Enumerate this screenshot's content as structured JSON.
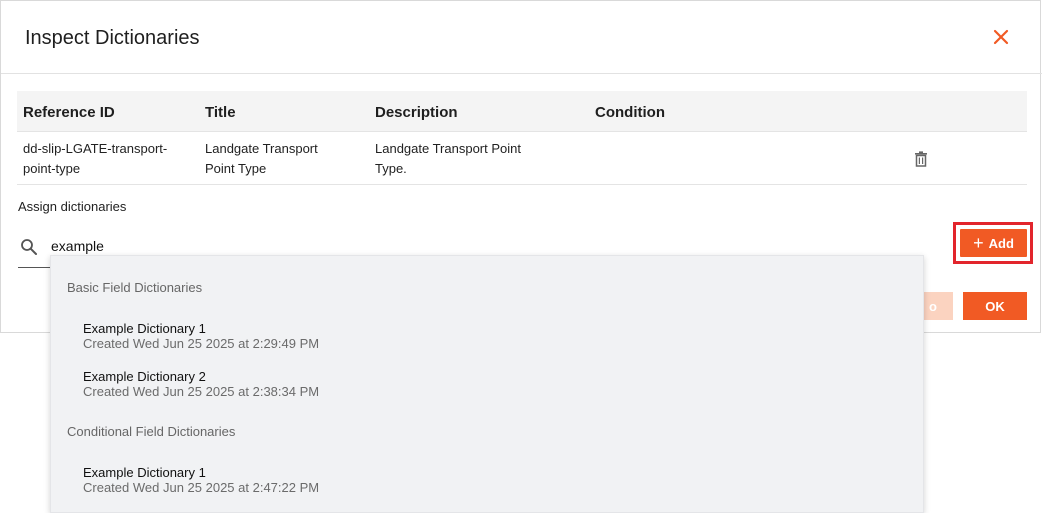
{
  "dialog": {
    "title": "Inspect Dictionaries",
    "close_icon": "close-icon",
    "accent_color": "#f15a24"
  },
  "table": {
    "headers": [
      "Reference ID",
      "Title",
      "Description",
      "Condition"
    ],
    "rows": [
      {
        "reference_id": "dd-slip-LGATE-transport-point-type",
        "title": "Landgate Transport Point Type",
        "description": "Landgate Transport Point Type.",
        "condition": "",
        "action_icon": "trash-icon"
      }
    ]
  },
  "assign": {
    "label": "Assign dictionaries",
    "search_value": "example",
    "search_icon": "search-icon",
    "add_label": "Add"
  },
  "footer": {
    "undo_label": "o",
    "ok_label": "OK"
  },
  "dropdown": {
    "groups": [
      {
        "header": "Basic Field Dictionaries",
        "options": [
          {
            "name": "Example Dictionary 1",
            "meta": "Created Wed Jun 25 2025 at 2:29:49 PM"
          },
          {
            "name": "Example Dictionary 2",
            "meta": "Created Wed Jun 25 2025 at 2:38:34 PM"
          }
        ]
      },
      {
        "header": "Conditional Field Dictionaries",
        "options": [
          {
            "name": "Example Dictionary 1",
            "meta": "Created Wed Jun 25 2025 at 2:47:22 PM"
          }
        ]
      }
    ]
  }
}
